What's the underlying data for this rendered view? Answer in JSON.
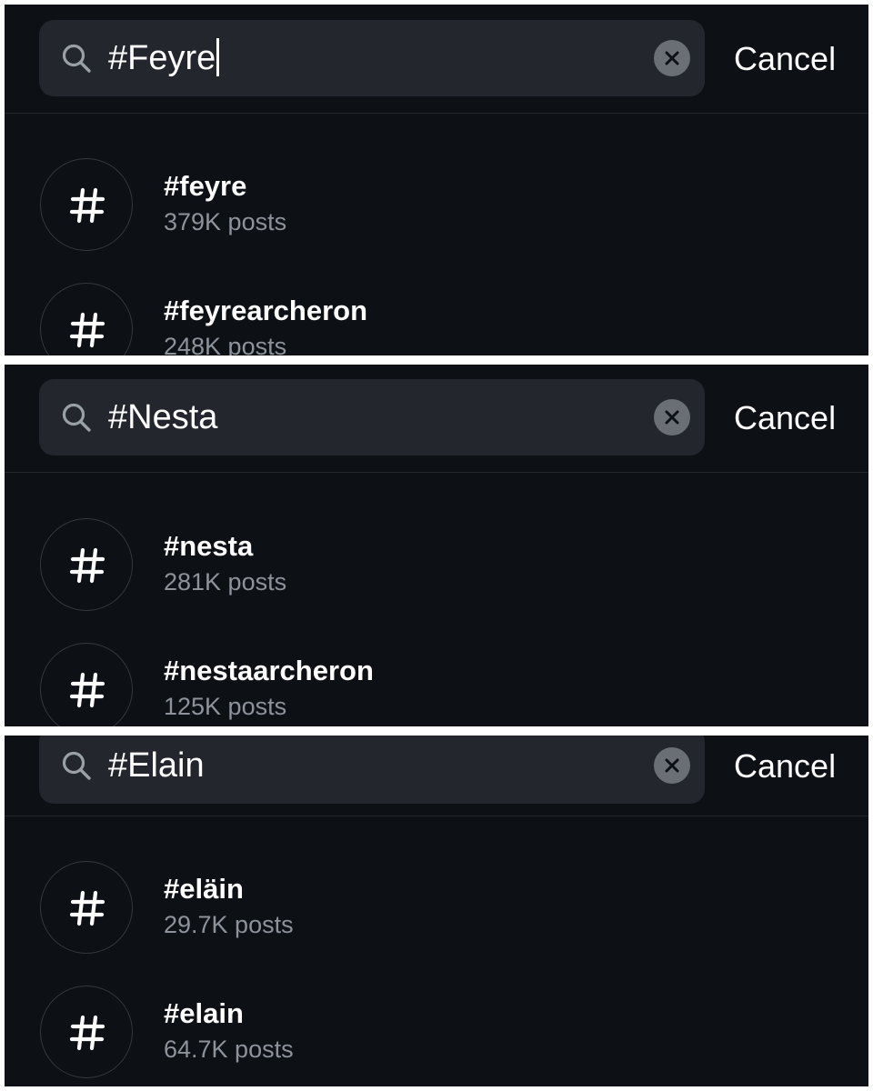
{
  "panels": [
    {
      "query": "#Feyre",
      "cancel_label": "Cancel",
      "results": [
        {
          "tag": "#feyre",
          "count": "379K posts"
        },
        {
          "tag": "#feyrearcheron",
          "count": "248K posts"
        }
      ]
    },
    {
      "query": "#Nesta",
      "cancel_label": "Cancel",
      "results": [
        {
          "tag": "#nesta",
          "count": "281K posts"
        },
        {
          "tag": "#nestaarcheron",
          "count": "125K posts"
        }
      ]
    },
    {
      "query": "#Elain",
      "cancel_label": "Cancel",
      "results": [
        {
          "tag": "#eläin",
          "count": "29.7K posts"
        },
        {
          "tag": "#elain",
          "count": "64.7K posts"
        }
      ]
    }
  ],
  "icons": {
    "search": "search-icon",
    "clear": "clear-icon",
    "hashtag": "hashtag-icon"
  },
  "colors": {
    "background": "#0d1015",
    "search_field": "#23262c",
    "primary_text": "#ffffff",
    "secondary_text": "#8d939b"
  }
}
